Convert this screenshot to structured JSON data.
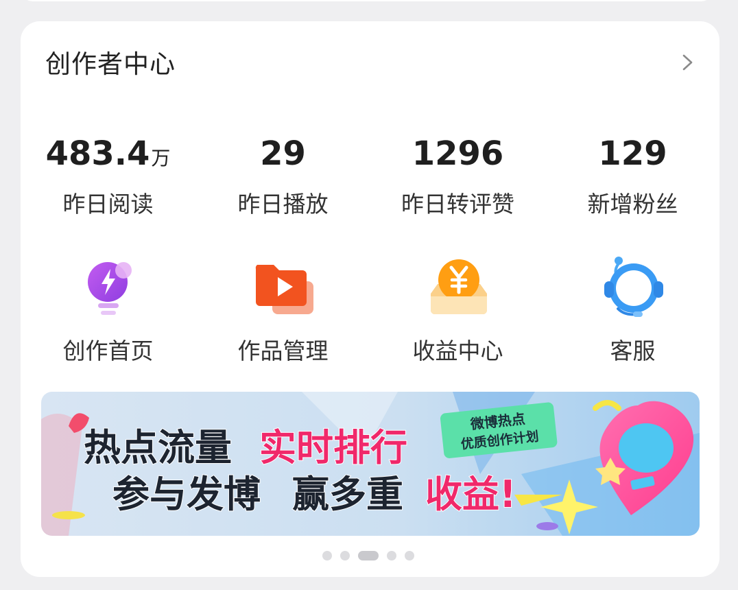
{
  "card": {
    "title": "创作者中心"
  },
  "stats": [
    {
      "value": "483.4",
      "unit": "万",
      "label": "昨日阅读"
    },
    {
      "value": "29",
      "unit": "",
      "label": "昨日播放"
    },
    {
      "value": "1296",
      "unit": "",
      "label": "昨日转评赞"
    },
    {
      "value": "129",
      "unit": "",
      "label": "新增粉丝"
    }
  ],
  "tools": [
    {
      "label": "创作首页",
      "icon": "lightbulb-icon"
    },
    {
      "label": "作品管理",
      "icon": "video-folder-icon"
    },
    {
      "label": "收益中心",
      "icon": "yuan-coin-icon"
    },
    {
      "label": "客服",
      "icon": "headset-icon"
    }
  ],
  "banner": {
    "line1a": "热点流量",
    "line1b": "实时排行",
    "line2a": "参与发博",
    "line2b": "赢多重",
    "line2c": "收益!",
    "tag_line1": "微博热点",
    "tag_line2": "优质创作计划"
  },
  "carousel": {
    "count": 5,
    "active_index": 2
  },
  "colors": {
    "background": "#efeff1",
    "card": "#ffffff",
    "text_primary": "#1f1f1f",
    "accent_pink": "#f0286a",
    "tag_green": "#3fd39b"
  }
}
